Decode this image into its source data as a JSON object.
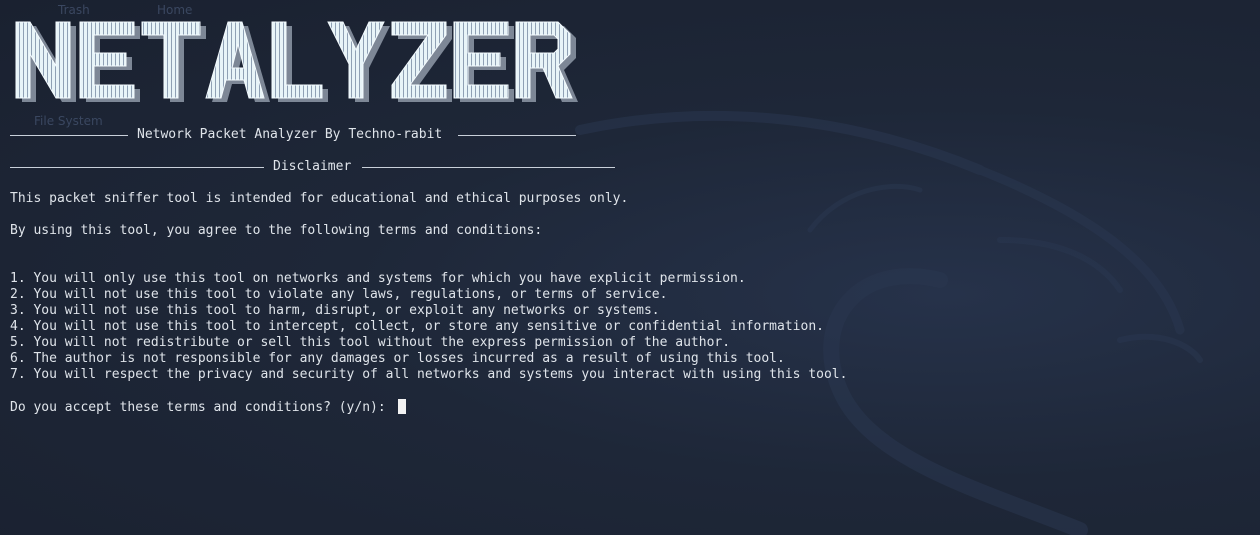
{
  "banner": {
    "art_text": "NETALYZER"
  },
  "desktop": {
    "ghost_items": [
      "Trash",
      "Home",
      "File System"
    ]
  },
  "terminal": {
    "subtitle": "Network Packet Analyzer By Techno-rabit",
    "disclaimer_heading": "Disclaimer",
    "intro": "This packet sniffer tool is intended for educational and ethical purposes only.",
    "agreement": "By using this tool, you agree to the following terms and conditions:",
    "terms": [
      "1. You will only use this tool on networks and systems for which you have explicit permission.",
      "2. You will not use this tool to violate any laws, regulations, or terms of service.",
      "3. You will not use this tool to harm, disrupt, or exploit any networks or systems.",
      "4. You will not use this tool to intercept, collect, or store any sensitive or confidential information.",
      "5. You will not redistribute or sell this tool without the express permission of the author.",
      "6. The author is not responsible for any damages or losses incurred as a result of using this tool.",
      "7. You will respect the privacy and security of all networks and systems you interact with using this tool."
    ],
    "prompt": "Do you accept these terms and conditions? (y/n): "
  },
  "colors": {
    "background": "#1c2433",
    "text": "#dfe4ea",
    "banner_fill": "#e8f4f8",
    "banner_shadow": "#aeb7c2"
  }
}
